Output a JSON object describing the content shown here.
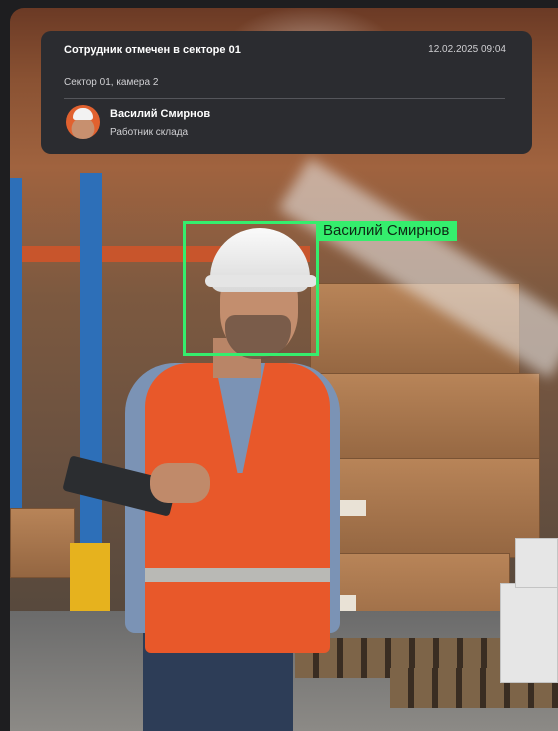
{
  "notification": {
    "title": "Сотрудник отмечен в секторе 01",
    "datetime": "12.02.2025  09:04",
    "location": "Сектор 01, камера 2",
    "user": {
      "name": "Василий Смирнов",
      "role": "Работник склада",
      "avatar_icon": "worker-avatar"
    }
  },
  "detection": {
    "label": "Василий Смирнов",
    "color": "#35ee6d"
  },
  "colors": {
    "card_background": "#2b2c30",
    "page_background": "#1e1e20",
    "accent_green": "#35ee6d"
  }
}
